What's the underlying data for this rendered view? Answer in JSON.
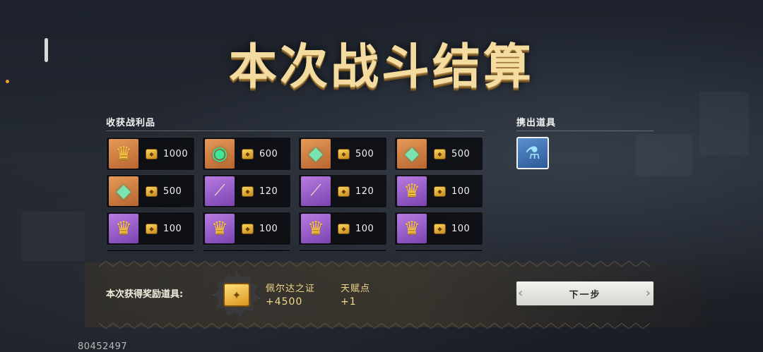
{
  "title": "本次战斗结算",
  "loot_section": {
    "label": "收获战利品"
  },
  "carry_section": {
    "label": "携出道具"
  },
  "loot_items": [
    {
      "icon": "crown-gem-icon",
      "rarity": "orange",
      "value": "1000"
    },
    {
      "icon": "emerald-medallion-icon",
      "rarity": "orange",
      "value": "600"
    },
    {
      "icon": "green-crystal-icon",
      "rarity": "orange",
      "value": "500"
    },
    {
      "icon": "green-crystal-icon",
      "rarity": "orange",
      "value": "500"
    },
    {
      "icon": "green-crystal-icon",
      "rarity": "orange",
      "value": "500"
    },
    {
      "icon": "scepter-icon",
      "rarity": "purple",
      "value": "120"
    },
    {
      "icon": "scepter-icon",
      "rarity": "purple",
      "value": "120"
    },
    {
      "icon": "crown-icon",
      "rarity": "purple",
      "value": "100"
    },
    {
      "icon": "crown-icon",
      "rarity": "purple",
      "value": "100"
    },
    {
      "icon": "crown-icon",
      "rarity": "purple",
      "value": "100"
    },
    {
      "icon": "crown-icon",
      "rarity": "purple",
      "value": "100"
    },
    {
      "icon": "crown-icon",
      "rarity": "purple",
      "value": "100"
    }
  ],
  "carry_item": {
    "icon": "potion-bottle-icon"
  },
  "reward": {
    "label": "本次获得奖励道具:",
    "items": [
      {
        "name": "佩尔达之证",
        "amount": "+4500"
      },
      {
        "name": "天赋点",
        "amount": "+1"
      }
    ]
  },
  "next_button": {
    "label": "下一步"
  },
  "player_uid": "80452497",
  "colors": {
    "title_gold": "#f4dca0",
    "reward_gold": "#f3d98a",
    "orange_rarity": "#e49a58",
    "purple_rarity": "#b77ce0"
  }
}
